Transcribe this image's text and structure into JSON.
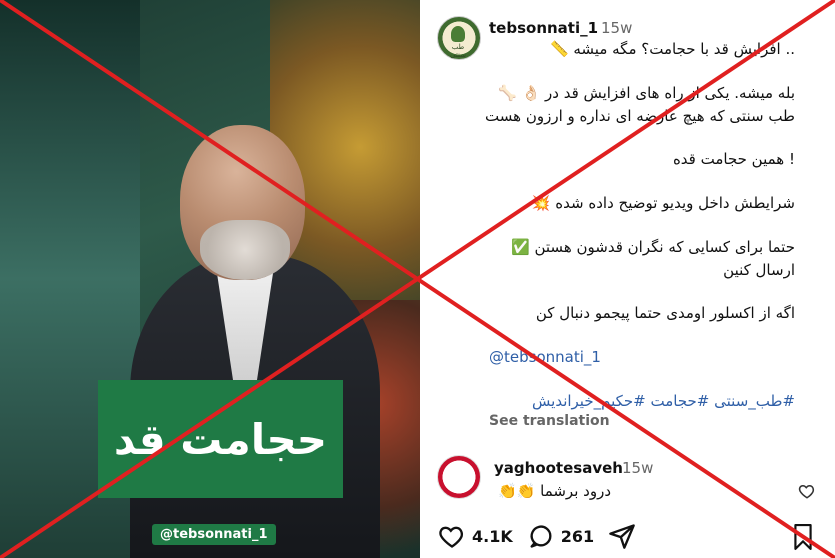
{
  "video": {
    "banner_text": "حجامت قد",
    "handle_tag": "@tebsonnati_1"
  },
  "post": {
    "avatar_label": "طب سنتی",
    "username": "tebsonnati_1",
    "age": "15w",
    "caption": {
      "line1": ".. افزایش قد با حجامت؟ مگه میشه 📏",
      "line2": "بله میشه. یکی از راه های افزایش قد در 👌🏻 🦴",
      "line3": "طب سنتی که هیچ عارضه ای نداره و ارزون هست",
      "line4": "! همین حجامت قده",
      "line5": "شرایطش داخل ویدیو توضیح داده شده 💥",
      "line6": "حتما برای کسایی که نگران قدشون هستن ✅",
      "line7": "ارسال کنین",
      "line8": "اگه از اکسلور اومدی حتما پیجمو دنبال کن",
      "mention": "@tebsonnati_1",
      "hashtags": "#طب_سنتی #حجامت #حکیم_خیراندیش"
    },
    "see_translation": "See translation"
  },
  "comment": {
    "username": "yaghootesaveh",
    "age": "15w",
    "text": "درود برشما 👏👏"
  },
  "actions": {
    "likes": "4.1K",
    "comments": "261"
  },
  "overlay": {
    "x_color": "#e02020"
  }
}
